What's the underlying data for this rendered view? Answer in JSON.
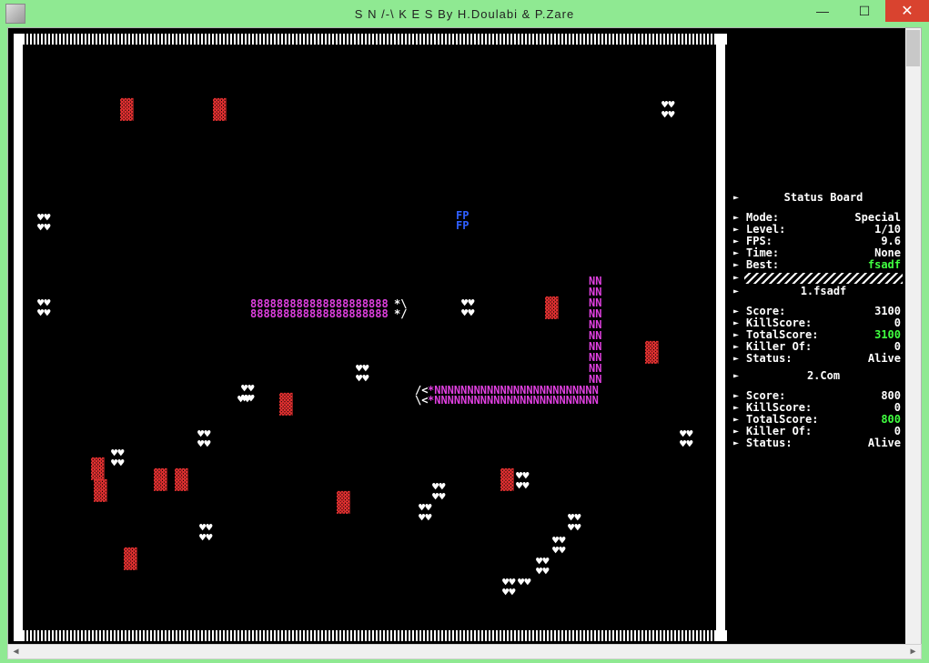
{
  "window": {
    "title": "S N /-\\ K E S  By H.Doulabi & P.Zare"
  },
  "status": {
    "title": "Status  Board",
    "mode_label": "Mode:",
    "mode_value": "Special",
    "level_label": "Level:",
    "level_value": "1/10",
    "fps_label": "FPS:",
    "fps_value": "9.6",
    "time_label": "Time:",
    "time_value": "None",
    "best_label": "Best:",
    "best_value": "fsadf"
  },
  "players": [
    {
      "name": "1.fsadf",
      "score_label": "Score:",
      "score_value": "3100",
      "killscore_label": "KillScore:",
      "killscore_value": "0",
      "totalscore_label": "TotalScore:",
      "totalscore_value": "3100",
      "killerof_label": "Killer Of:",
      "killerof_value": "0",
      "status_label": "Status:",
      "status_value": "Alive"
    },
    {
      "name": "2.Com",
      "score_label": "Score:",
      "score_value": "800",
      "killscore_label": "KillScore:",
      "killscore_value": "0",
      "totalscore_label": "TotalScore:",
      "totalscore_value": "800",
      "killerof_label": "Killer Of:",
      "killerof_value": "0",
      "status_label": "Status:",
      "status_value": "Alive"
    }
  ],
  "game": {
    "fp": "FP",
    "heart": "♥♥",
    "block": "▓▓",
    "snake1_body": "888888888888888888888",
    "snake1_head": "*\\",
    "snake1_head2": "*/",
    "snake2_seg": "NN",
    "snake2_long1": "*NNNNNNNNNNNNNNNNNNNNNNNNN",
    "snake2_long2": "*NNNNNNNNNNNNNNNNNNNNNNNNN",
    "snake2_head": "/<",
    "snake2_head2": "\\<"
  }
}
